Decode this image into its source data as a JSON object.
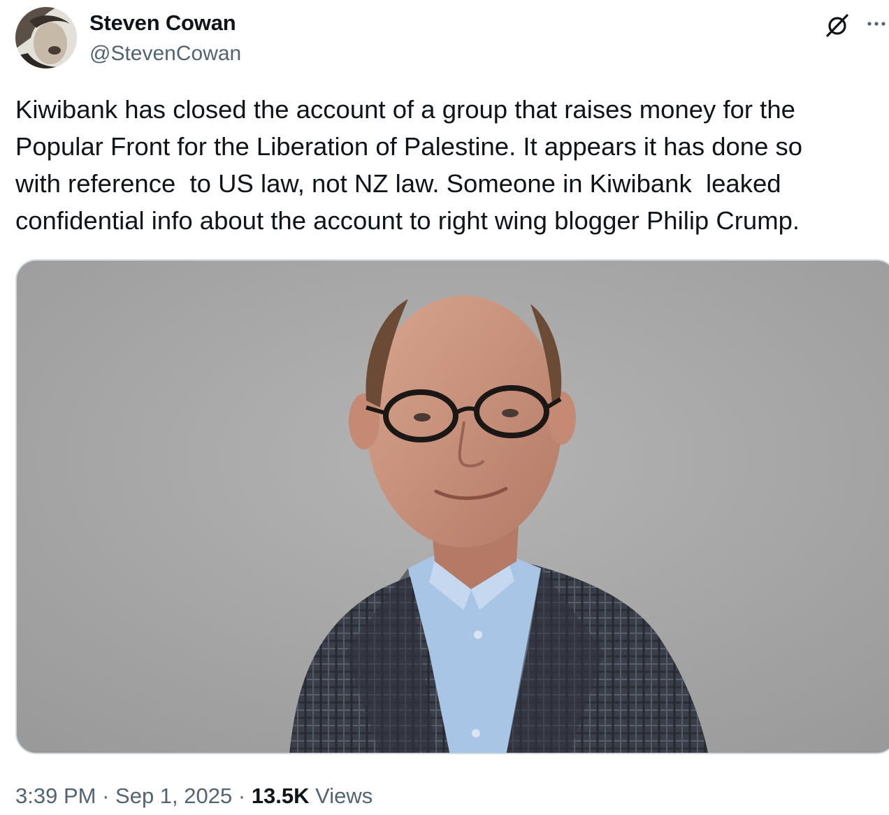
{
  "author": {
    "display_name": "Steven Cowan",
    "handle": "@StevenCowan"
  },
  "tweet": {
    "text": "Kiwibank has closed the account of a group that raises money for the\nPopular Front for the Liberation of Palestine. It appears it has done so\nwith reference  to US law, not NZ law. Someone in Kiwibank  leaked\nconfidential info about the account to right wing blogger Philip Crump."
  },
  "meta": {
    "time": "3:39 PM",
    "separator": "·",
    "date": "Sep 1, 2025",
    "views_count": "13.5K",
    "views_label": "Views"
  },
  "icons": {
    "grok": "grok-icon",
    "more": "more-icon"
  },
  "colors": {
    "text_primary": "#0f1419",
    "text_secondary": "#536471",
    "border": "#cfd9de",
    "photo_background": "#a3a3a3"
  }
}
